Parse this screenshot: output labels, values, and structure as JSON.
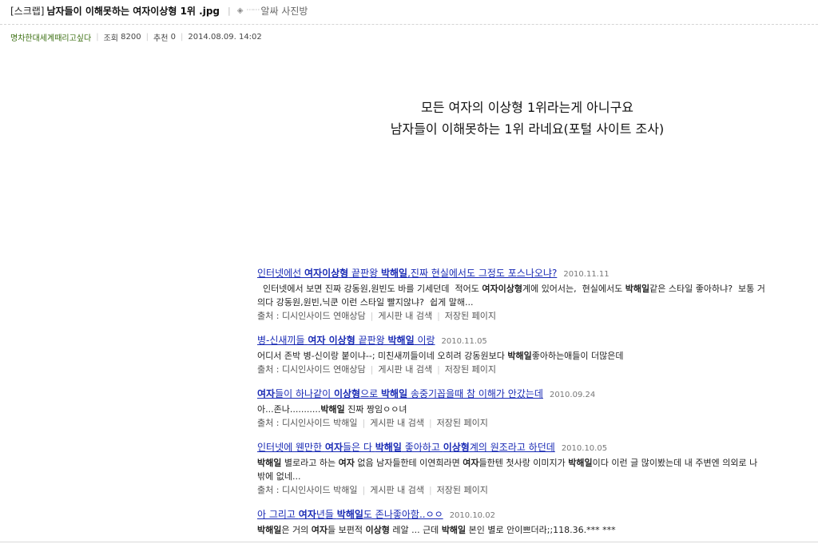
{
  "header": {
    "prefix": "[스크랩]",
    "post_title": "남자들이 이해못하는 여자이상형 1위 .jpg",
    "separator": "|",
    "board_marker": "◈",
    "board_dots": "⋯⋯",
    "board_name": "알싸 사진방"
  },
  "meta": {
    "author": "명차한대세계때리고싶다",
    "views_label": "조회",
    "views": "8200",
    "recommend_label": "추천",
    "recommend": "0",
    "datetime": "2014.08.09. 14:02"
  },
  "headline": {
    "line1": "모든 여자의 이상형 1위라는게 아니구요",
    "line2": "남자들이 이해못하는 1위 라네요(포털 사이트 조사)"
  },
  "results": [
    {
      "title_html": "인터넷에선 <b>여자이상형</b> 끝판왕 <b>박해일</b>,진짜 현실에서도 그정도 포스나오냐?",
      "date": "2010.11.11",
      "snippet_html": "&nbsp;&nbsp;인터넷에서 보면 진짜 강동원,원빈도 바를 기세던데 &nbsp;적어도 <b>여자이상형</b>계에 있어서는, &nbsp;현실에서도 <b>박해일</b>같은 스타일 좋아하냐? &nbsp;보통 거의다 강동원,원빈,닉쿤 이런 스타일 빨지않냐? &nbsp;쉽게 말해...",
      "source": "출처 : 디시인사이드 연애상담",
      "board_search": "게시판 내 검색",
      "saved_page": "저장된 페이지"
    },
    {
      "title_html": "병-신새끼들 <b>여자 이상형</b> 끝판왕 <b>박해일</b> 이랑",
      "date": "2010.11.05",
      "snippet_html": "어디서 존박 병-신이랑 붙이냐--; 미친새끼들이네 오히려 강동원보다 <b>박해일</b>좋아하는애들이 더많은데",
      "source": "출처 : 디시인사이드 연애상담",
      "board_search": "게시판 내 검색",
      "saved_page": "저장된 페이지"
    },
    {
      "title_html": "<b>여자</b>들이 하나같이 <b>이상형</b>으로 <b>박해일</b> 송중기꼽을때 참 이해가 안갔는데",
      "date": "2010.09.24",
      "snippet_html": "아...존나...........<b>박해일</b> 진짜 짱임ㅇㅇ녀",
      "source": "출처 : 디시인사이드 박해일",
      "board_search": "게시판 내 검색",
      "saved_page": "저장된 페이지"
    },
    {
      "title_html": "인터넷에 웬만한 <b>여자</b>들은 다 <b>박해일</b> 좋아하고 <b>이상형</b>계의 원조라고 하던데",
      "date": "2010.10.05",
      "snippet_html": "<b>박해일</b> 별로라고 하는 <b>여자</b> 없음 남자들한테 이연희라면 <b>여자</b>들한텐 첫사랑 이미지가 <b>박해일</b>이다 이런 글 많이봤는데 내 주변엔 의외로 나밖에 없네...",
      "source": "출처 : 디시인사이드 박해일",
      "board_search": "게시판 내 검색",
      "saved_page": "저장된 페이지"
    },
    {
      "title_html": "아 그리고 <b>여자</b>년들 <b>박해일</b>도 존나좋아함..ㅇㅇ",
      "date": "2010.10.02",
      "snippet_html": "<b>박해일</b>은 거의 <b>여자</b>들 보편적 <b>이상형</b> 레알 ... 근데 <b>박해일</b> 본인 별로 안이쁘더라;;118.36.*** ***",
      "source": "",
      "board_search": "",
      "saved_page": ""
    }
  ]
}
